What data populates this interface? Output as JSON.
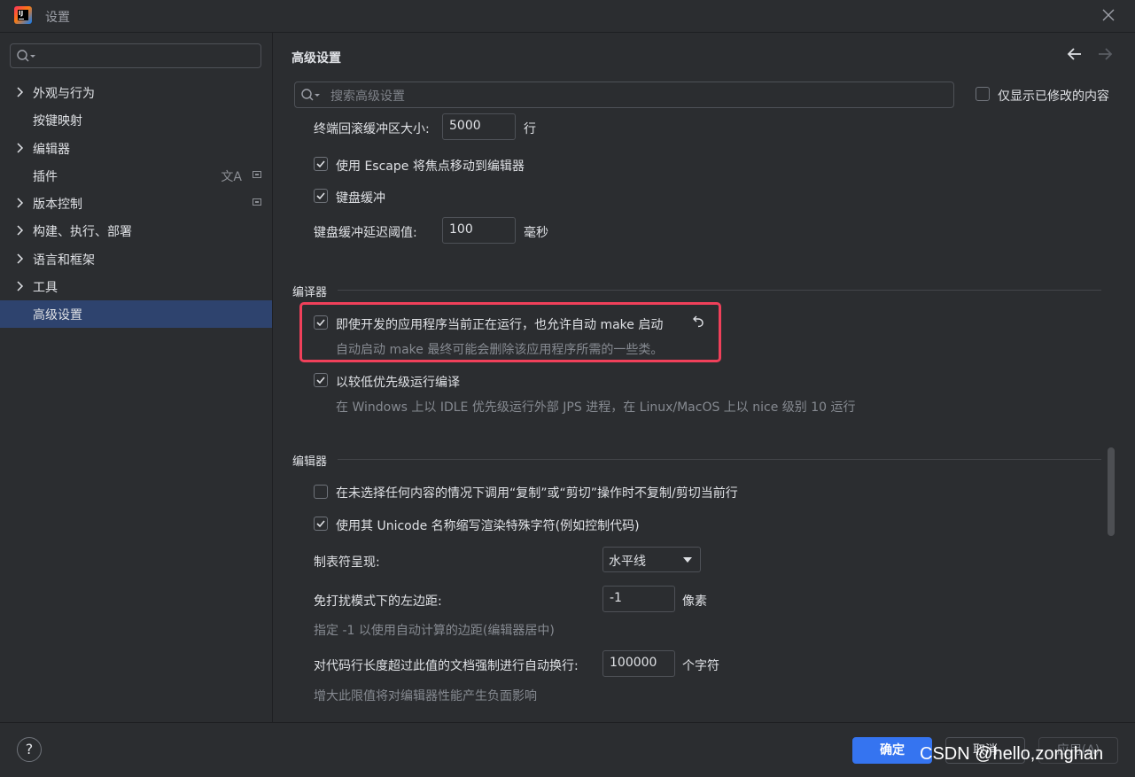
{
  "window": {
    "title": "设置"
  },
  "sidebar": {
    "search_placeholder": "",
    "items": [
      {
        "label": "外观与行为",
        "has_chevron": true
      },
      {
        "label": "按键映射",
        "has_chevron": false
      },
      {
        "label": "编辑器",
        "has_chevron": true
      },
      {
        "label": "插件",
        "has_chevron": false
      },
      {
        "label": "版本控制",
        "has_chevron": true
      },
      {
        "label": "构建、执行、部署",
        "has_chevron": true
      },
      {
        "label": "语言和框架",
        "has_chevron": true
      },
      {
        "label": "工具",
        "has_chevron": true
      },
      {
        "label": "高级设置",
        "has_chevron": false,
        "selected": true
      }
    ]
  },
  "content": {
    "title": "高级设置",
    "search_placeholder": "搜索高级设置",
    "only_modified_label": "仅显示已修改的内容",
    "terminal": {
      "scrollback_label": "终端回滚缓冲区大小:",
      "scrollback_value": "5000",
      "scrollback_unit": "行",
      "escape_label": "使用 Escape 将焦点移动到编辑器",
      "keyboard_buffer_label": "键盘缓冲",
      "buffer_delay_label": "键盘缓冲延迟阈值:",
      "buffer_delay_value": "100",
      "buffer_delay_unit": "毫秒"
    },
    "compiler_section": {
      "title": "编译器",
      "auto_make_label": "即使开发的应用程序当前正在运行，也允许自动 make 启动",
      "auto_make_hint": "自动启动 make 最终可能会删除该应用程序所需的一些类。",
      "low_priority_label": "以较低优先级运行编译",
      "low_priority_hint": "在 Windows 上以 IDLE 优先级运行外部 JPS 进程，在 Linux/MacOS 上以 nice 级别 10 运行"
    },
    "editor_section": {
      "title": "编辑器",
      "copy_label": "在未选择任何内容的情况下调用“复制”或“剪切”操作时不复制/剪切当前行",
      "unicode_label": "使用其 Unicode 名称缩写渲染特殊字符(例如控制代码)",
      "tab_render_label": "制表符呈现:",
      "tab_render_value": "水平线",
      "zen_margin_label": "免打扰模式下的左边距:",
      "zen_margin_value": "-1",
      "zen_margin_unit": "像素",
      "zen_margin_hint": "指定 -1 以使用自动计算的边距(编辑器居中)",
      "soft_wrap_label": "对代码行长度超过此值的文档强制进行自动换行:",
      "soft_wrap_value": "100000",
      "soft_wrap_unit": "个字符",
      "soft_wrap_hint": "增大此限值将对编辑器性能产生负面影响"
    }
  },
  "footer": {
    "help": "?",
    "ok": "确定",
    "cancel": "取消",
    "apply": "应用(A)",
    "watermark": "CSDN @hello,zonghan"
  },
  "colors": {
    "accent": "#3574f0",
    "selection": "#2e436e",
    "highlight_box": "#f0405a"
  }
}
